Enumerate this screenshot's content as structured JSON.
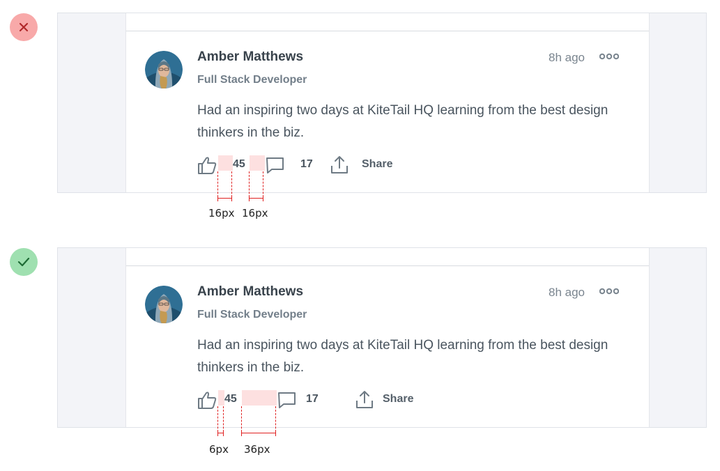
{
  "colors": {
    "error_badge": "#f8a9a9",
    "success_badge": "#9fe0b0",
    "highlight": "#fde0e0",
    "measure_line": "#e02020"
  },
  "examples": [
    {
      "status": "incorrect",
      "status_icon": "x-icon",
      "post": {
        "author": "Amber Matthews",
        "role": "Full Stack Developer",
        "time": "8h ago",
        "text": "Had an inspiring two days at KiteTail HQ learning from the best design thinkers in the biz.",
        "likes": "45",
        "comments": "17",
        "share_label": "Share"
      },
      "spacing": {
        "like_to_count": "16px",
        "count_to_comment": "16px"
      }
    },
    {
      "status": "correct",
      "status_icon": "check-icon",
      "post": {
        "author": "Amber Matthews",
        "role": "Full Stack Developer",
        "time": "8h ago",
        "text": "Had an inspiring two days at KiteTail HQ learning from the best design thinkers in the biz.",
        "likes": "45",
        "comments": "17",
        "share_label": "Share"
      },
      "spacing": {
        "like_to_count": "6px",
        "count_to_comment": "36px"
      }
    }
  ]
}
